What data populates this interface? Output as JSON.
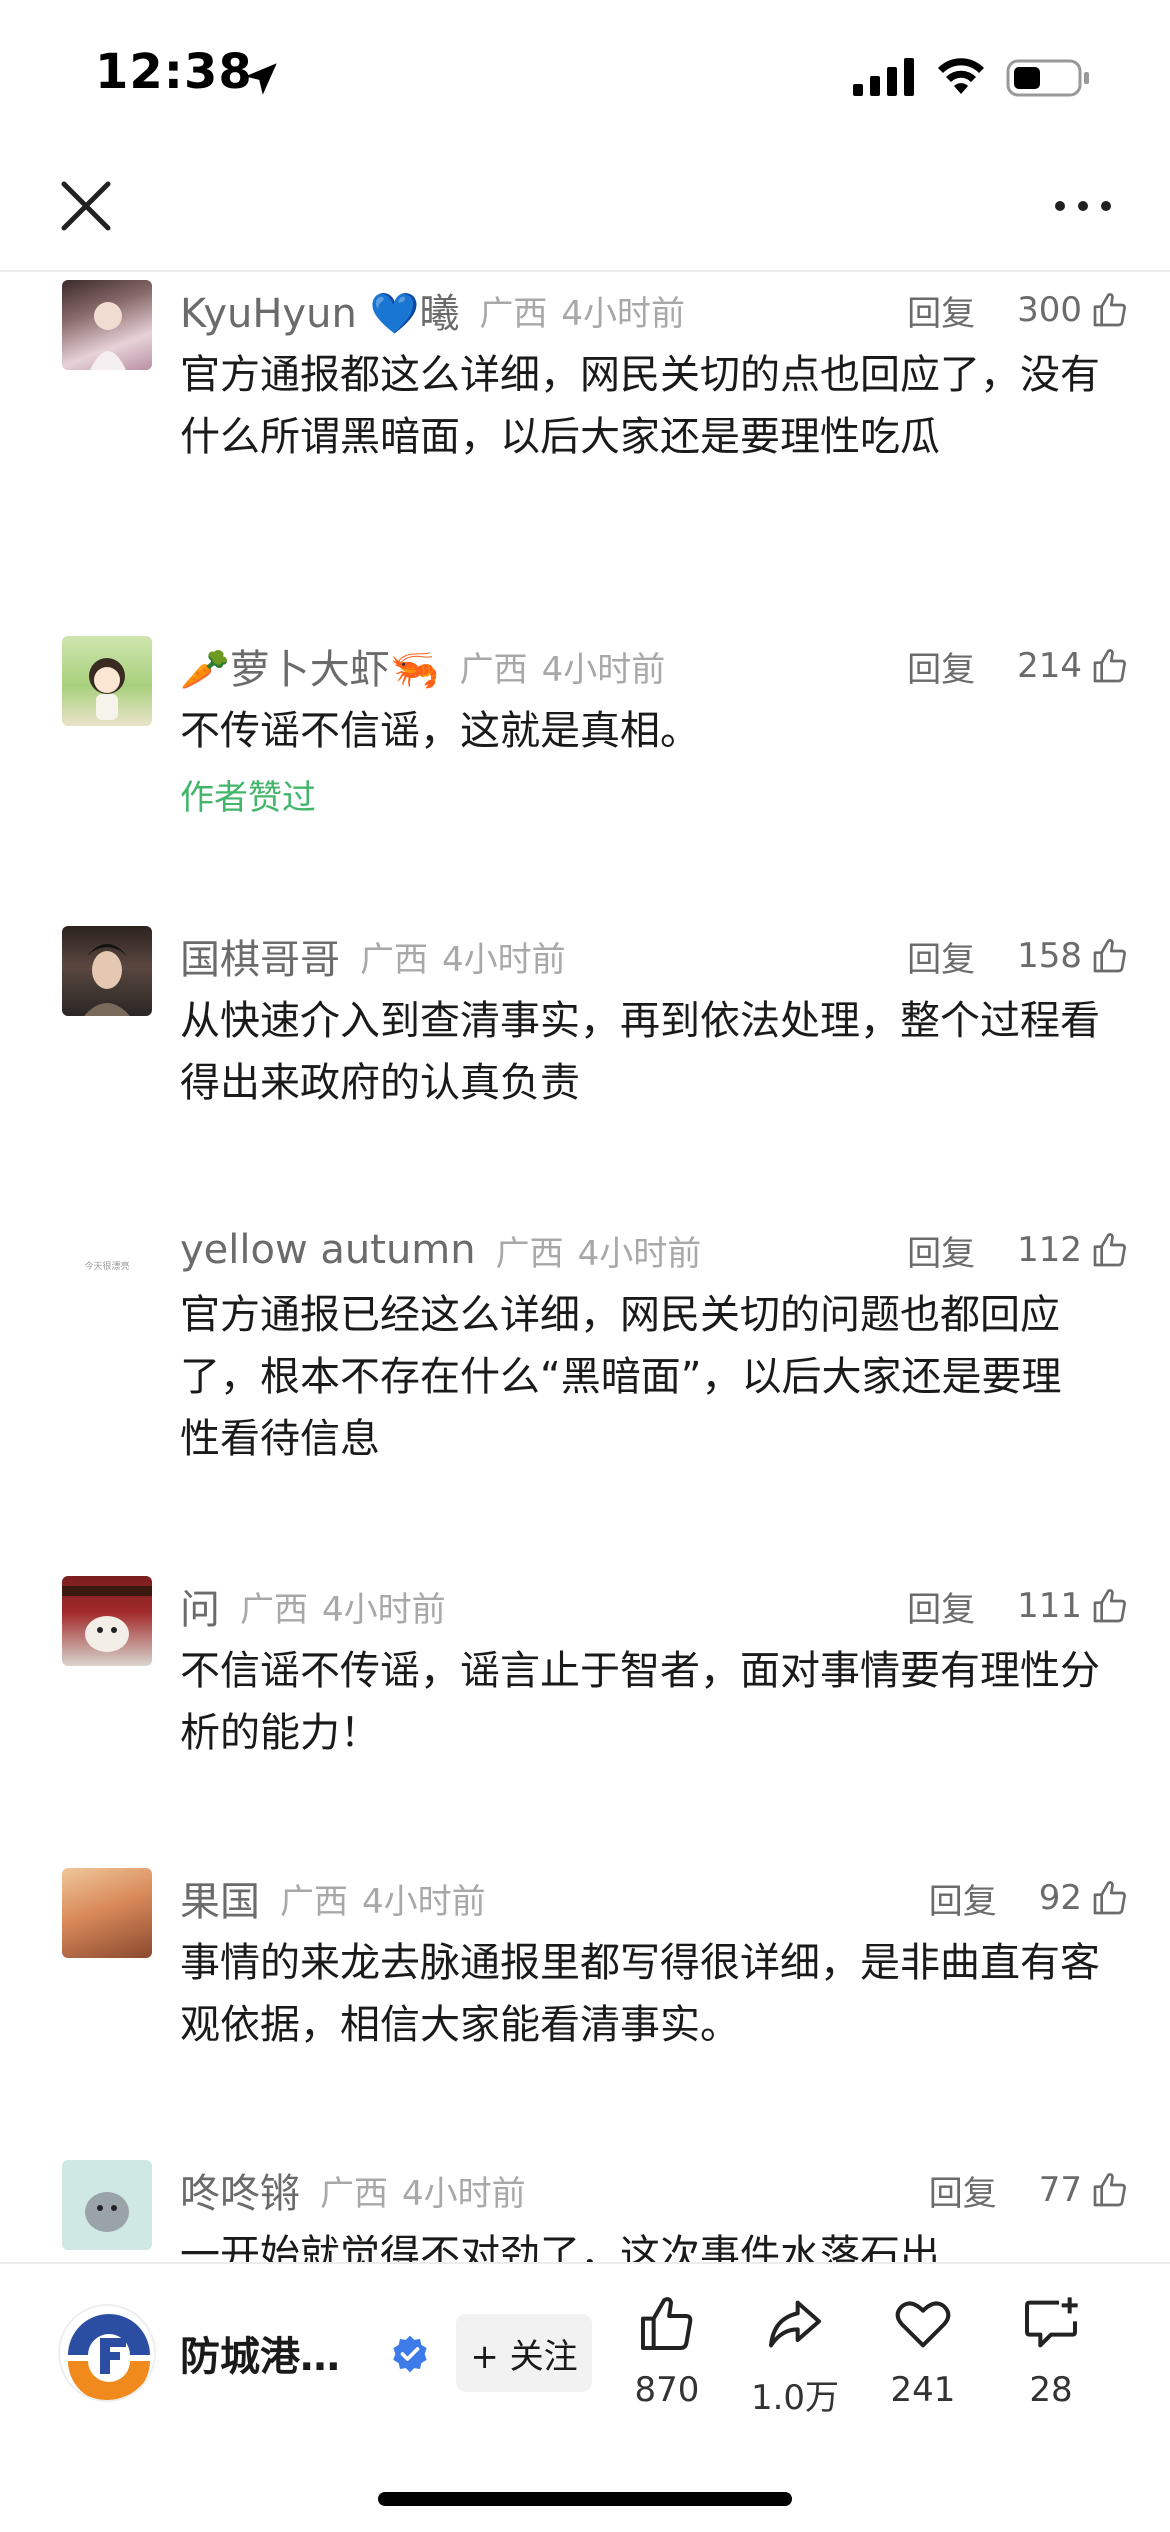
{
  "status_bar": {
    "time": "12:38"
  },
  "header": {
    "close_icon": "close-icon",
    "more_icon": "more-dots-icon"
  },
  "comments": [
    {
      "name": "KyuHyun 💙曦",
      "location": "广西",
      "time": "4小时前",
      "reply": "回复",
      "likes": "300",
      "text": "官方通报都这么详细，网民关切的点也回应了，没有什么所谓黑暗面，以后大家还是要理性吃瓜",
      "badge": ""
    },
    {
      "name": "🥕萝卜大虾🦐",
      "location": "广西",
      "time": "4小时前",
      "reply": "回复",
      "likes": "214",
      "text": "不传谣不信谣，这就是真相。",
      "badge": "作者赞过"
    },
    {
      "name": "国棋哥哥",
      "location": "广西",
      "time": "4小时前",
      "reply": "回复",
      "likes": "158",
      "text": "从快速介入到查清事实，再到依法处理，整个过程看得出来政府的认真负责",
      "badge": ""
    },
    {
      "name": "yellow autumn",
      "location": "广西",
      "time": "4小时前",
      "reply": "回复",
      "likes": "112",
      "text": "官方通报已经这么详细，网民关切的问题也都回应了，根本不存在什么“黑暗面”，以后大家还是要理性看待信息",
      "badge": ""
    },
    {
      "name": "问",
      "location": "广西",
      "time": "4小时前",
      "reply": "回复",
      "likes": "111",
      "text": "不信谣不传谣，谣言止于智者，面对事情要有理性分析的能力！",
      "badge": ""
    },
    {
      "name": "果国",
      "location": "广西",
      "time": "4小时前",
      "reply": "回复",
      "likes": "92",
      "text": "事情的来龙去脉通报里都写得很详细，是非曲直有客观依据，相信大家能看清事实。",
      "badge": ""
    },
    {
      "name": "咚咚锵",
      "location": "广西",
      "time": "4小时前",
      "reply": "回复",
      "likes": "77",
      "text": "一开始就觉得不对劲了，这次事件水落石出",
      "badge": ""
    }
  ],
  "avatar4_text": "今天很漂亮",
  "bottom_bar": {
    "account_name": "防城港…",
    "follow_label": "+ 关注",
    "actions": [
      {
        "icon": "thumbs-up-icon",
        "count": "870"
      },
      {
        "icon": "share-icon",
        "count": "1.0万"
      },
      {
        "icon": "heart-icon",
        "count": "241"
      },
      {
        "icon": "comment-add-icon",
        "count": "28"
      }
    ]
  }
}
